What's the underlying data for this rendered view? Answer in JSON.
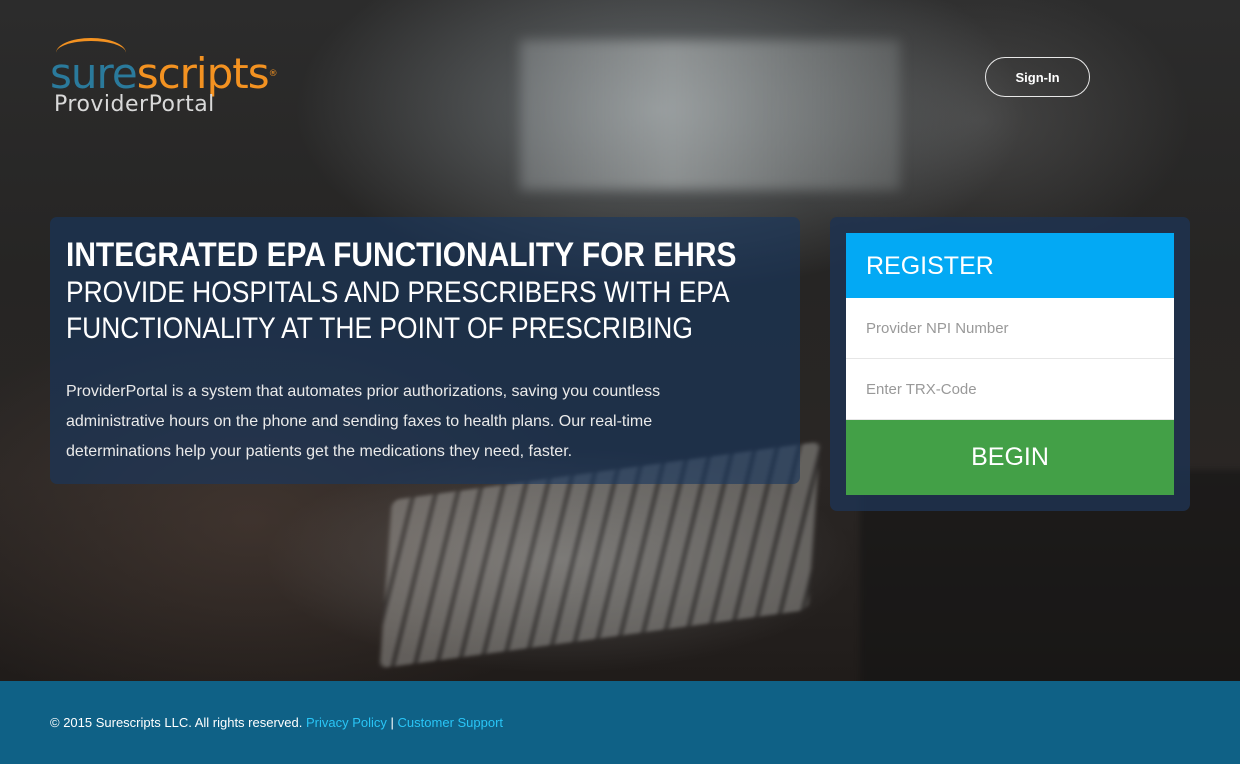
{
  "header": {
    "logo_primary_a": "sure",
    "logo_primary_b": "scripts",
    "logo_reg": "®",
    "logo_sub": "ProviderPortal",
    "signin_label": "Sign-In"
  },
  "info": {
    "title": "INTEGRATED EPA FUNCTIONALITY FOR EHRS",
    "subtitle": "PROVIDE HOSPITALS AND PRESCRIBERS WITH EPA FUNCTIONALITY AT THE POINT OF PRESCRIBING",
    "body": "ProviderPortal is a system that automates prior authorizations, saving you countless administrative hours on the phone and sending faxes to health plans. Our real-time determinations help your patients get the medications they need, faster."
  },
  "register": {
    "heading": "REGISTER",
    "npi_placeholder": "Provider NPI Number",
    "trx_placeholder": "Enter TRX-Code",
    "begin_label": "BEGIN"
  },
  "footer": {
    "copyright": "© 2015 Surescripts LLC. All rights reserved.",
    "privacy_label": "Privacy Policy",
    "separator": "|",
    "support_label": "Customer Support"
  },
  "colors": {
    "accent_blue": "#03a9f4",
    "begin_green": "#43a047",
    "footer_bg": "#0f6186",
    "logo_orange": "#f39221",
    "logo_teal": "#2a7a9c"
  }
}
